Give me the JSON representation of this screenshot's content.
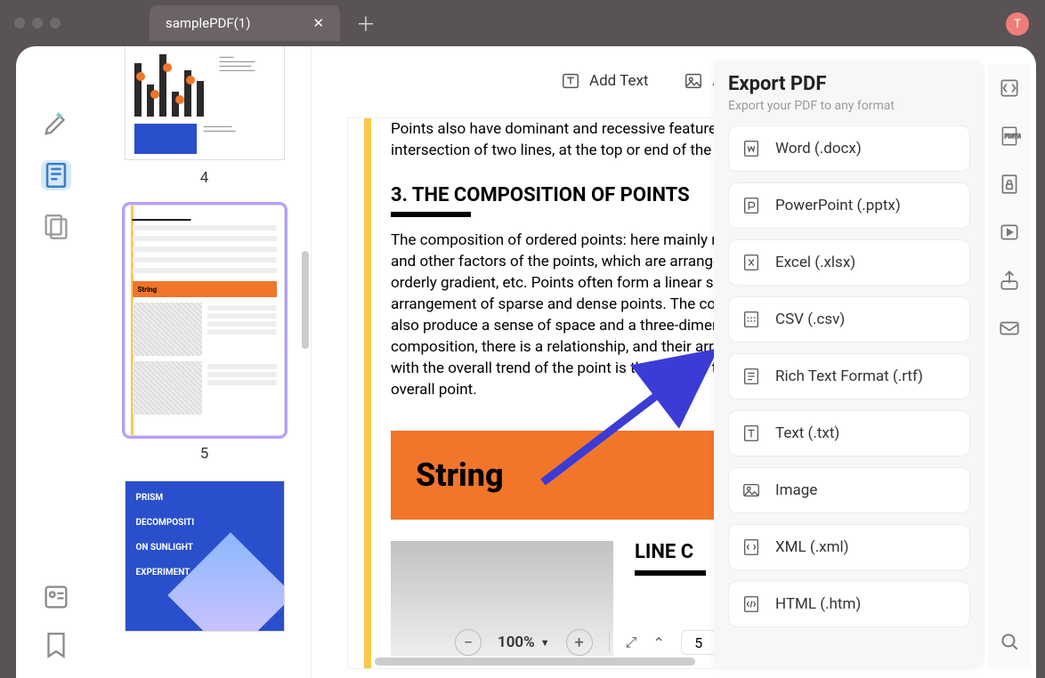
{
  "tab": {
    "title": "samplePDF(1)"
  },
  "avatar": {
    "initial": "T"
  },
  "thumbs": {
    "p4_label": "4",
    "p5_label": "5",
    "p5_string": "String"
  },
  "t6": {
    "l1": "PRISM",
    "l2": "DECOMPOSITI",
    "l3": "ON SUNLIGHT",
    "l4": "EXPERIMENT"
  },
  "toolbar": {
    "add_text": "Add Text",
    "add_image_initial": "A"
  },
  "page": {
    "intro": "Points also have dominant and recessive features, such as at the intersection of two lines, at the top or end of the line.",
    "h3": "3. THE COMPOSITION OF POINTS",
    "body": "The composition of ordered points: here mainly refers to the size, direction and other factors of the points, which are arranged in repetition, or an orderly gradient, etc. Points often form a linear space through the arrangement of sparse and dense points. The composition of points will also produce a sense of space and a three-dimensional dimension. In the composition, there is a relationship, and their arrangement is combined with the overall trend of the point is the line and the surface, which is the overall point.",
    "orange": "String",
    "h4": "LINE C"
  },
  "bottom": {
    "zoom": "100%",
    "page": "5"
  },
  "export": {
    "title": "Export PDF",
    "sub": "Export your PDF to any format",
    "opts": {
      "word": "Word (.docx)",
      "ppt": "PowerPoint (.pptx)",
      "xls": "Excel (.xlsx)",
      "csv": "CSV (.csv)",
      "rtf": "Rich Text Format (.rtf)",
      "txt": "Text (.txt)",
      "img": "Image",
      "xml": "XML (.xml)",
      "htm": "HTML (.htm)"
    }
  }
}
